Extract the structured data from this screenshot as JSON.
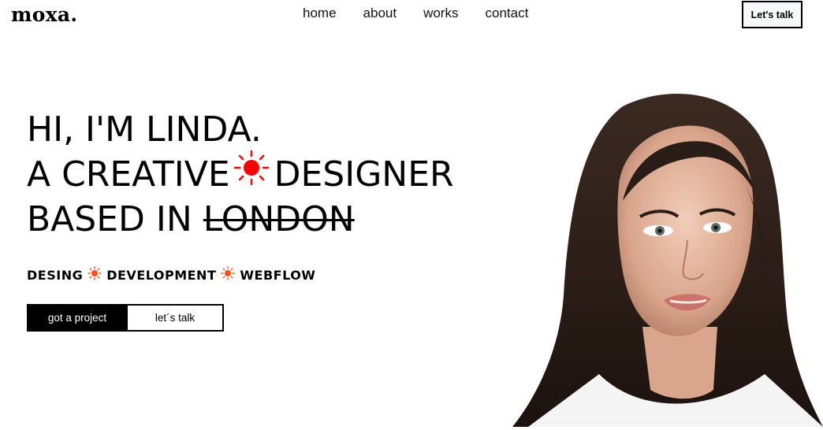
{
  "brand": {
    "logo": "moxa."
  },
  "nav": {
    "items": [
      "home",
      "about",
      "works",
      "contact"
    ]
  },
  "header": {
    "cta_label": "Let's talk"
  },
  "hero": {
    "line1": "HI, I'M LINDA.",
    "line2_pre": "A CREATIVE",
    "line2_post": "DESIGNER",
    "line3_pre": "BASED IN",
    "line3_strike": "LONDON",
    "skills": [
      "DESING",
      "DEVELOPMENT",
      "WEBFLOW"
    ],
    "primary_cta": "got a project",
    "secondary_cta": "let´s talk"
  },
  "icons": {
    "sun_icon": "sun-icon",
    "portrait": "portrait-photo"
  },
  "colors": {
    "accent": "#ff0000",
    "accent_small": "#ff4d1a",
    "text": "#000000",
    "background": "#ffffff"
  }
}
